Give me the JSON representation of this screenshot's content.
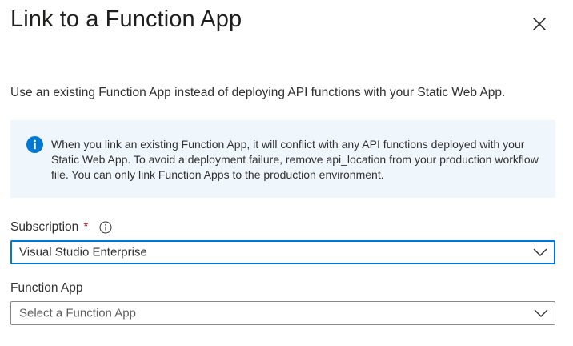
{
  "panel": {
    "title": "Link to a Function App",
    "description": "Use an existing Function App instead of deploying API functions with your Static Web App."
  },
  "info": {
    "text": "When you link an existing Function App, it will conflict with any API functions deployed with your Static Web App. To avoid a deployment failure, remove api_location from your production workflow file. You can only link Function Apps to the production environment.",
    "icon": "info-icon",
    "accent_color": "#0078d4",
    "background_color": "#eff6fc"
  },
  "subscription": {
    "label": "Subscription",
    "required_marker": "*",
    "selected_value": "Visual Studio Enterprise",
    "focused": true
  },
  "function_app": {
    "label": "Function App",
    "placeholder": "Select a Function App"
  },
  "icons": {
    "close": "close-icon",
    "help": "info-circle-icon",
    "dropdown": "chevron-down-icon"
  }
}
